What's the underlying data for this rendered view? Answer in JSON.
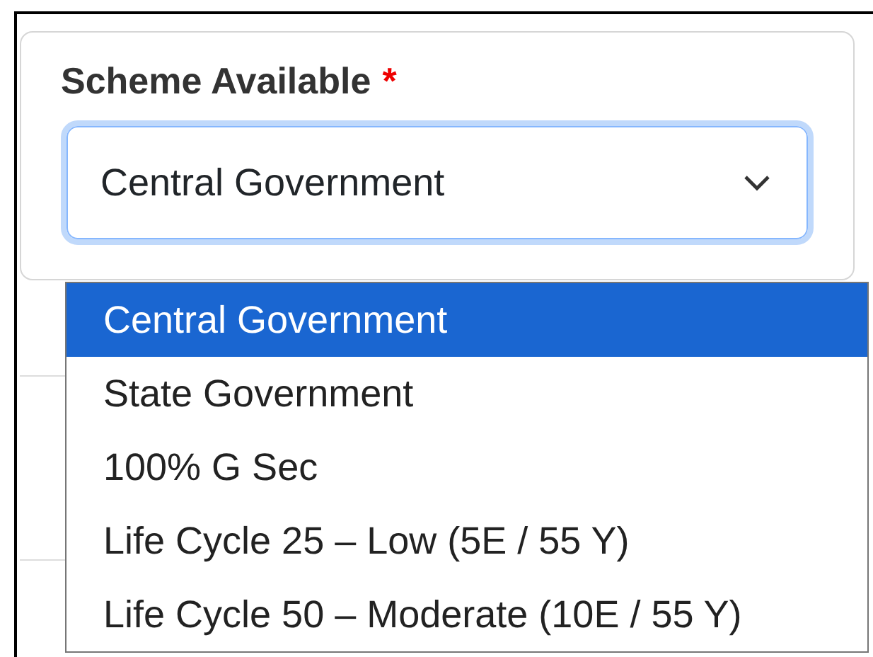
{
  "field": {
    "label": "Scheme Available",
    "required_mark": "*",
    "value": "Central Government",
    "expanded": true,
    "options": [
      {
        "label": "Central Government",
        "selected": true
      },
      {
        "label": "State Government",
        "selected": false
      },
      {
        "label": "100% G Sec",
        "selected": false
      },
      {
        "label": "Life Cycle 25 – Low (5E / 55 Y)",
        "selected": false
      },
      {
        "label": "Life Cycle 50 – Moderate (10E / 55 Y)",
        "selected": false
      }
    ]
  }
}
